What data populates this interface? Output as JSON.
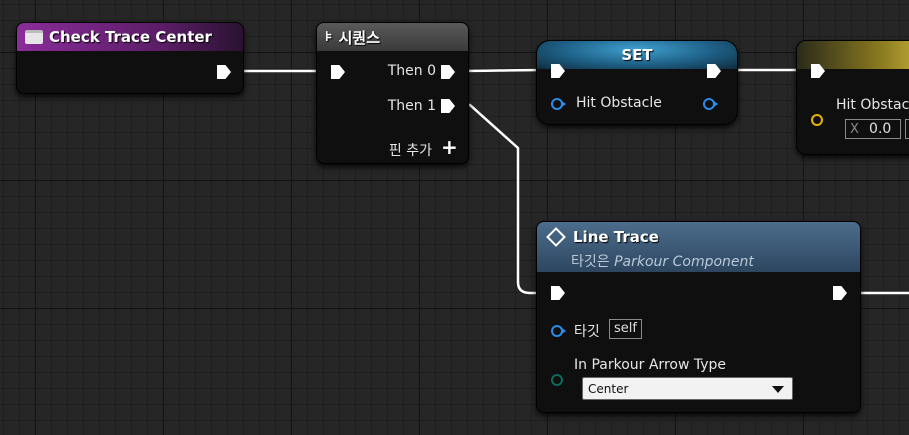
{
  "nodes": {
    "event": {
      "title": "Check Trace Center",
      "color": "#8a2c99"
    },
    "sequence": {
      "title": "시퀀스",
      "then0": "Then 0",
      "then1": "Then 1",
      "add_pin": "핀 추가"
    },
    "set": {
      "title": "SET",
      "var": "Hit Obstacle"
    },
    "partial": {
      "label": "Hit Obstacle",
      "x_label": "X",
      "x_value": "0.0"
    },
    "line_trace": {
      "title": "Line Trace",
      "subtitle_prefix": "타깃은",
      "subtitle_target": "Parkour Component",
      "target_label": "타깃",
      "target_value": "self",
      "arrow_label": "In Parkour Arrow Type",
      "arrow_value": "Center"
    }
  },
  "icons": [
    "event-icon",
    "sequence-icon",
    "function-icon",
    "plus-icon",
    "dropdown-arrow-icon"
  ],
  "colors": {
    "bool_pin": "#2a8be6",
    "vector_pin": "#e3b400",
    "enum_pin": "#0e6a5a",
    "event_header": "#8a2c99",
    "set_header": "#2b8fc2",
    "function_header": "#456a8a"
  }
}
